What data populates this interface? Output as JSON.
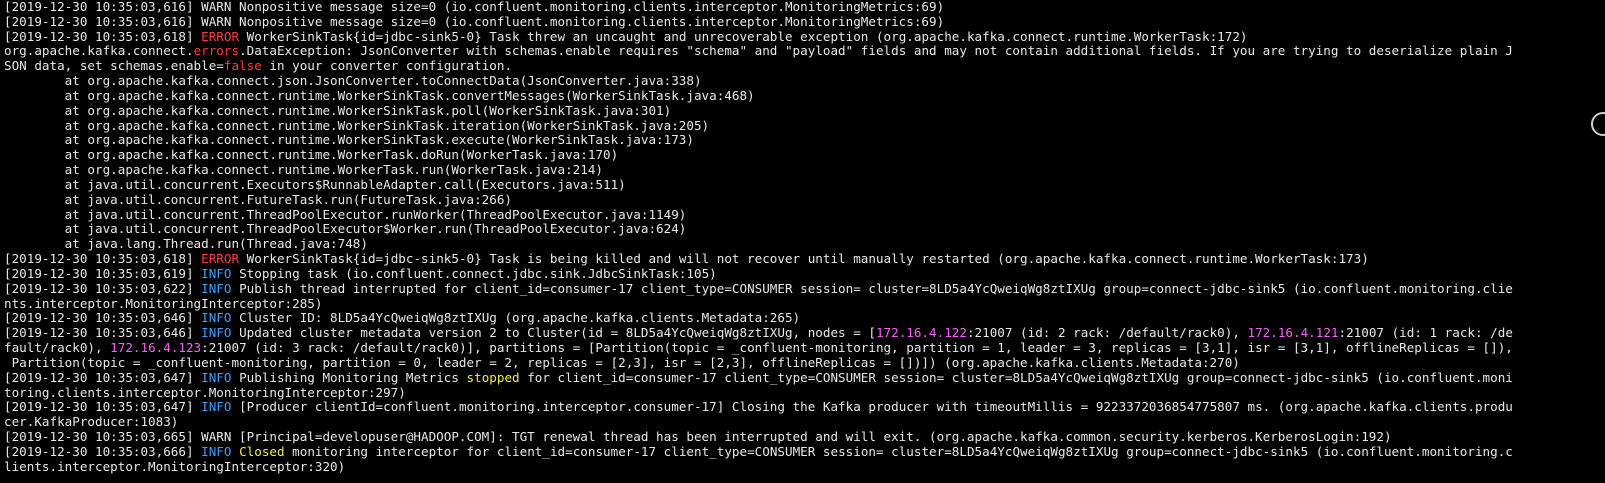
{
  "terminal": {
    "colors": {
      "background": "#000000",
      "text": "#e8e8e8",
      "error": "#ff3a3a",
      "info": "#3aa0ff",
      "ip": "#ff5cff",
      "highlight": "#f2e94b"
    },
    "lines": [
      [
        {
          "t": "[2019-12-30 10:35:03,616] WARN Nonpositive message size=0 (io.confluent.monitoring.clients.interceptor.MonitoringMetrics:69)",
          "c": "plain"
        }
      ],
      [
        {
          "t": "[2019-12-30 10:35:03,616] WARN Nonpositive message size=0 (io.confluent.monitoring.clients.interceptor.MonitoringMetrics:69)",
          "c": "plain"
        }
      ],
      [
        {
          "t": "[2019-12-30 10:35:03,618] ",
          "c": "plain"
        },
        {
          "t": "ERROR",
          "c": "error"
        },
        {
          "t": " WorkerSinkTask{id=jdbc-sink5-0} Task threw an uncaught and unrecoverable exception (org.apache.kafka.connect.runtime.WorkerTask:172)",
          "c": "plain"
        }
      ],
      [
        {
          "t": "org.apache.kafka.connect.",
          "c": "plain"
        },
        {
          "t": "errors",
          "c": "error"
        },
        {
          "t": ".DataException: JsonConverter with schemas.enable requires \"schema\" and \"payload\" fields and may not contain additional fields. If you are trying to deserialize plain J",
          "c": "plain"
        }
      ],
      [
        {
          "t": "SON data, set schemas.enable=",
          "c": "plain"
        },
        {
          "t": "false",
          "c": "error"
        },
        {
          "t": " in your converter configuration.",
          "c": "plain"
        }
      ],
      [
        {
          "t": "        at org.apache.kafka.connect.json.JsonConverter.toConnectData(JsonConverter.java:338)",
          "c": "plain"
        }
      ],
      [
        {
          "t": "        at org.apache.kafka.connect.runtime.WorkerSinkTask.convertMessages(WorkerSinkTask.java:468)",
          "c": "plain"
        }
      ],
      [
        {
          "t": "        at org.apache.kafka.connect.runtime.WorkerSinkTask.poll(WorkerSinkTask.java:301)",
          "c": "plain"
        }
      ],
      [
        {
          "t": "        at org.apache.kafka.connect.runtime.WorkerSinkTask.iteration(WorkerSinkTask.java:205)",
          "c": "plain"
        }
      ],
      [
        {
          "t": "        at org.apache.kafka.connect.runtime.WorkerSinkTask.execute(WorkerSinkTask.java:173)",
          "c": "plain"
        }
      ],
      [
        {
          "t": "        at org.apache.kafka.connect.runtime.WorkerTask.doRun(WorkerTask.java:170)",
          "c": "plain"
        }
      ],
      [
        {
          "t": "        at org.apache.kafka.connect.runtime.WorkerTask.run(WorkerTask.java:214)",
          "c": "plain"
        }
      ],
      [
        {
          "t": "        at java.util.concurrent.Executors$RunnableAdapter.call(Executors.java:511)",
          "c": "plain"
        }
      ],
      [
        {
          "t": "        at java.util.concurrent.FutureTask.run(FutureTask.java:266)",
          "c": "plain"
        }
      ],
      [
        {
          "t": "        at java.util.concurrent.ThreadPoolExecutor.runWorker(ThreadPoolExecutor.java:1149)",
          "c": "plain"
        }
      ],
      [
        {
          "t": "        at java.util.concurrent.ThreadPoolExecutor$Worker.run(ThreadPoolExecutor.java:624)",
          "c": "plain"
        }
      ],
      [
        {
          "t": "        at java.lang.Thread.run(Thread.java:748)",
          "c": "plain"
        }
      ],
      [
        {
          "t": "[2019-12-30 10:35:03,618] ",
          "c": "plain"
        },
        {
          "t": "ERROR",
          "c": "error"
        },
        {
          "t": " WorkerSinkTask{id=jdbc-sink5-0} Task is being killed and will not recover until manually restarted (org.apache.kafka.connect.runtime.WorkerTask:173)",
          "c": "plain"
        }
      ],
      [
        {
          "t": "[2019-12-30 10:35:03,619] ",
          "c": "plain"
        },
        {
          "t": "INFO",
          "c": "info"
        },
        {
          "t": " Stopping task (io.confluent.connect.jdbc.sink.JdbcSinkTask:105)",
          "c": "plain"
        }
      ],
      [
        {
          "t": "[2019-12-30 10:35:03,622] ",
          "c": "plain"
        },
        {
          "t": "INFO",
          "c": "info"
        },
        {
          "t": " Publish thread interrupted for client_id=consumer-17 client_type=CONSUMER session= cluster=8LD5a4YcQweiqWg8ztIXUg group=connect-jdbc-sink5 (io.confluent.monitoring.clie",
          "c": "plain"
        }
      ],
      [
        {
          "t": "nts.interceptor.MonitoringInterceptor:285)",
          "c": "plain"
        }
      ],
      [
        {
          "t": "[2019-12-30 10:35:03,646] ",
          "c": "plain"
        },
        {
          "t": "INFO",
          "c": "info"
        },
        {
          "t": " Cluster ID: 8LD5a4YcQweiqWg8ztIXUg (org.apache.kafka.clients.Metadata:265)",
          "c": "plain"
        }
      ],
      [
        {
          "t": "[2019-12-30 10:35:03,646] ",
          "c": "plain"
        },
        {
          "t": "INFO",
          "c": "info"
        },
        {
          "t": " Updated cluster metadata version 2 to Cluster(id = 8LD5a4YcQweiqWg8ztIXUg, nodes = [",
          "c": "plain"
        },
        {
          "t": "172.16.4.122",
          "c": "ip"
        },
        {
          "t": ":21007 (id: 2 rack: /default/rack0), ",
          "c": "plain"
        },
        {
          "t": "172.16.4.121",
          "c": "ip"
        },
        {
          "t": ":21007 (id: 1 rack: /de",
          "c": "plain"
        }
      ],
      [
        {
          "t": "fault/rack0), ",
          "c": "plain"
        },
        {
          "t": "172.16.4.123",
          "c": "ip"
        },
        {
          "t": ":21007 (id: 3 rack: /default/rack0)], partitions = [Partition(topic = _confluent-monitoring, partition = 1, leader = 3, replicas = [3,1], isr = [3,1], offlineReplicas = []),",
          "c": "plain"
        }
      ],
      [
        {
          "t": " Partition(topic = _confluent-monitoring, partition = 0, leader = 2, replicas = [2,3], isr = [2,3], offlineReplicas = [])]) (org.apache.kafka.clients.Metadata:270)",
          "c": "plain"
        }
      ],
      [
        {
          "t": "[2019-12-30 10:35:03,647] ",
          "c": "plain"
        },
        {
          "t": "INFO",
          "c": "info"
        },
        {
          "t": " Publishing Monitoring Metrics ",
          "c": "plain"
        },
        {
          "t": "stopped",
          "c": "yellow"
        },
        {
          "t": " for client_id=consumer-17 client_type=CONSUMER session= cluster=8LD5a4YcQweiqWg8ztIXUg group=connect-jdbc-sink5 (io.confluent.moni",
          "c": "plain"
        }
      ],
      [
        {
          "t": "toring.clients.interceptor.MonitoringInterceptor:297)",
          "c": "plain"
        }
      ],
      [
        {
          "t": "[2019-12-30 10:35:03,647] ",
          "c": "plain"
        },
        {
          "t": "INFO",
          "c": "info"
        },
        {
          "t": " [Producer clientId=confluent.monitoring.interceptor.consumer-17] Closing the Kafka producer with timeoutMillis = 9223372036854775807 ms. (org.apache.kafka.clients.produ",
          "c": "plain"
        }
      ],
      [
        {
          "t": "cer.KafkaProducer:1083)",
          "c": "plain"
        }
      ],
      [
        {
          "t": "[2019-12-30 10:35:03,665] WARN [Principal=developuser@HADOOP.COM]: TGT renewal thread has been interrupted and will exit. (org.apache.kafka.common.security.kerberos.KerberosLogin:192)",
          "c": "plain"
        }
      ],
      [
        {
          "t": "[2019-12-30 10:35:03,666] ",
          "c": "plain"
        },
        {
          "t": "INFO",
          "c": "info"
        },
        {
          "t": " ",
          "c": "plain"
        },
        {
          "t": "Closed",
          "c": "yellow"
        },
        {
          "t": " monitoring interceptor for client_id=consumer-17 client_type=CONSUMER session= cluster=8LD5a4YcQweiqWg8ztIXUg group=connect-jdbc-sink5 (io.confluent.monitoring.c",
          "c": "plain"
        }
      ],
      [
        {
          "t": "lients.interceptor.MonitoringInterceptor:320)",
          "c": "plain"
        }
      ]
    ]
  }
}
